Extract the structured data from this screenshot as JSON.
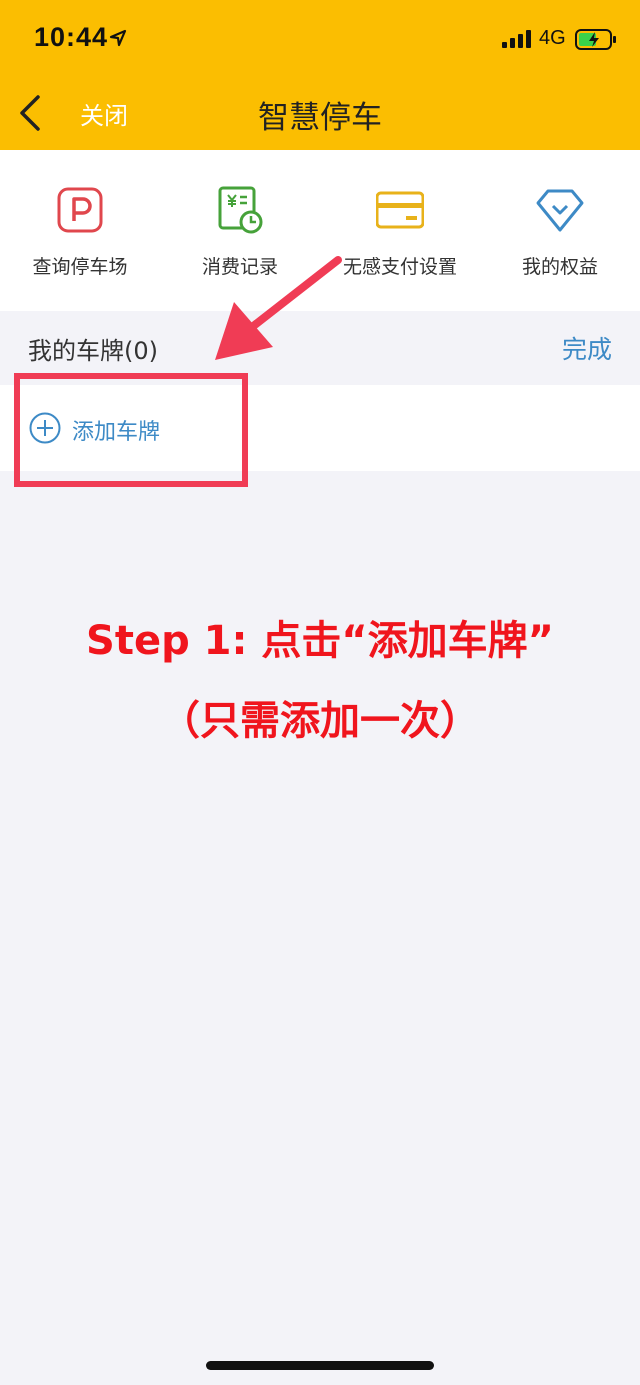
{
  "status_bar": {
    "time": "10:44",
    "network": "4G"
  },
  "nav": {
    "close_label": "关闭",
    "title": "智慧停车"
  },
  "shortcuts": [
    {
      "label": "查询停车场",
      "icon": "parking-icon",
      "color": "#e0474d"
    },
    {
      "label": "消费记录",
      "icon": "receipt-clock-icon",
      "color": "#46a23a"
    },
    {
      "label": "无感支付设置",
      "icon": "card-icon",
      "color": "#e8b21a"
    },
    {
      "label": "我的权益",
      "icon": "diamond-icon",
      "color": "#3d8ac6"
    }
  ],
  "plates": {
    "title": "我的车牌(0)",
    "done_label": "完成",
    "add_label": "添加车牌"
  },
  "annotation": {
    "line1": "Step 1: 点击“添加车牌”",
    "line2": "（只需添加一次）",
    "color": "#f0151d"
  },
  "colors": {
    "header": "#fbbe01",
    "accent": "#3d8ac6",
    "highlight": "#f03c55"
  }
}
